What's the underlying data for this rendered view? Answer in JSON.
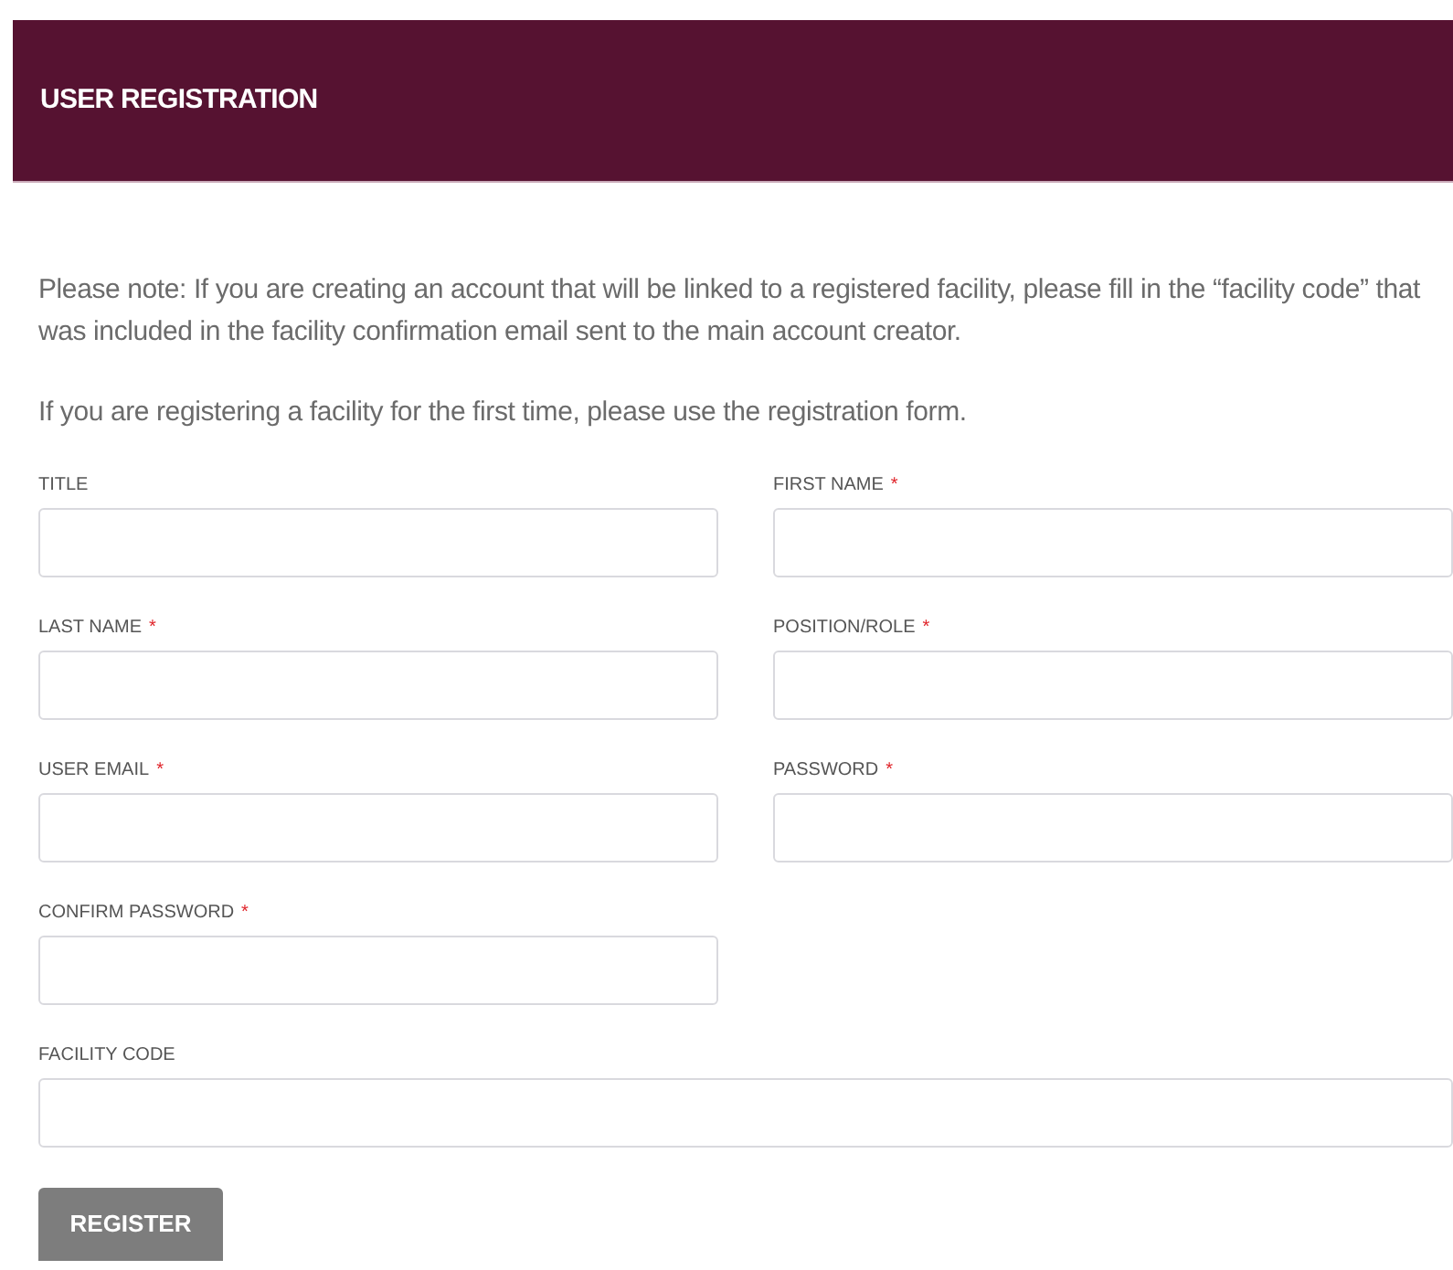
{
  "header": {
    "title": "USER REGISTRATION"
  },
  "notes": [
    "Please note: If you are creating an account that will be linked to a registered facility, please fill in the “facility code” that was included in the facility confirmation email sent to the main account creator.",
    "If you are registering a facility for the first time, please use the registration form."
  ],
  "fields": [
    {
      "label": "TITLE",
      "required": false,
      "kind": "half"
    },
    {
      "label": "FIRST NAME",
      "required": true,
      "kind": "half"
    },
    {
      "label": "LAST NAME",
      "required": true,
      "kind": "half"
    },
    {
      "label": "POSITION/ROLE",
      "required": true,
      "kind": "half"
    },
    {
      "label": "USER EMAIL",
      "required": true,
      "kind": "half"
    },
    {
      "label": "PASSWORD",
      "required": true,
      "kind": "half"
    },
    {
      "label": "CONFIRM PASSWORD",
      "required": true,
      "kind": "half"
    },
    {
      "label": "FACILITY CODE",
      "required": false,
      "kind": "full"
    }
  ],
  "required_mark": "*",
  "submit": {
    "label": "REGISTER"
  }
}
